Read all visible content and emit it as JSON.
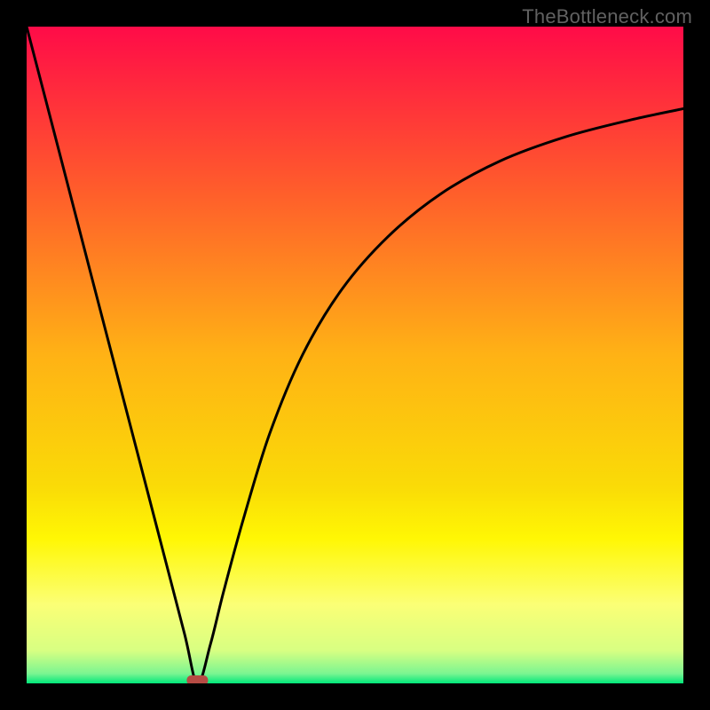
{
  "attribution": "TheBottleneck.com",
  "chart_data": {
    "type": "line",
    "title": "",
    "xlabel": "",
    "ylabel": "",
    "xlim": [
      0,
      100
    ],
    "ylim": [
      0,
      100
    ],
    "grid": false,
    "background": {
      "type": "vertical-gradient",
      "stops": [
        {
          "pos": 0.0,
          "color": "#ff0b48"
        },
        {
          "pos": 0.25,
          "color": "#ff5d2b"
        },
        {
          "pos": 0.5,
          "color": "#ffb215"
        },
        {
          "pos": 0.7,
          "color": "#fadb07"
        },
        {
          "pos": 0.78,
          "color": "#fff704"
        },
        {
          "pos": 0.88,
          "color": "#fbff76"
        },
        {
          "pos": 0.95,
          "color": "#d8ff82"
        },
        {
          "pos": 0.985,
          "color": "#7bf591"
        },
        {
          "pos": 1.0,
          "color": "#00e77a"
        }
      ]
    },
    "marker": {
      "x": 26,
      "y": 0,
      "color": "#b64b44",
      "shape": "rounded-rect"
    },
    "series": [
      {
        "name": "curve",
        "color": "#000000",
        "x": [
          0,
          5,
          10,
          15,
          20,
          24,
          26,
          28,
          30,
          33,
          37,
          42,
          48,
          55,
          63,
          72,
          82,
          92,
          100
        ],
        "values": [
          100,
          80.8,
          61.5,
          42.3,
          23.1,
          7.7,
          0,
          6.0,
          14.0,
          25.0,
          38.0,
          50.0,
          60.0,
          68.0,
          74.5,
          79.5,
          83.2,
          85.8,
          87.5
        ]
      }
    ]
  }
}
